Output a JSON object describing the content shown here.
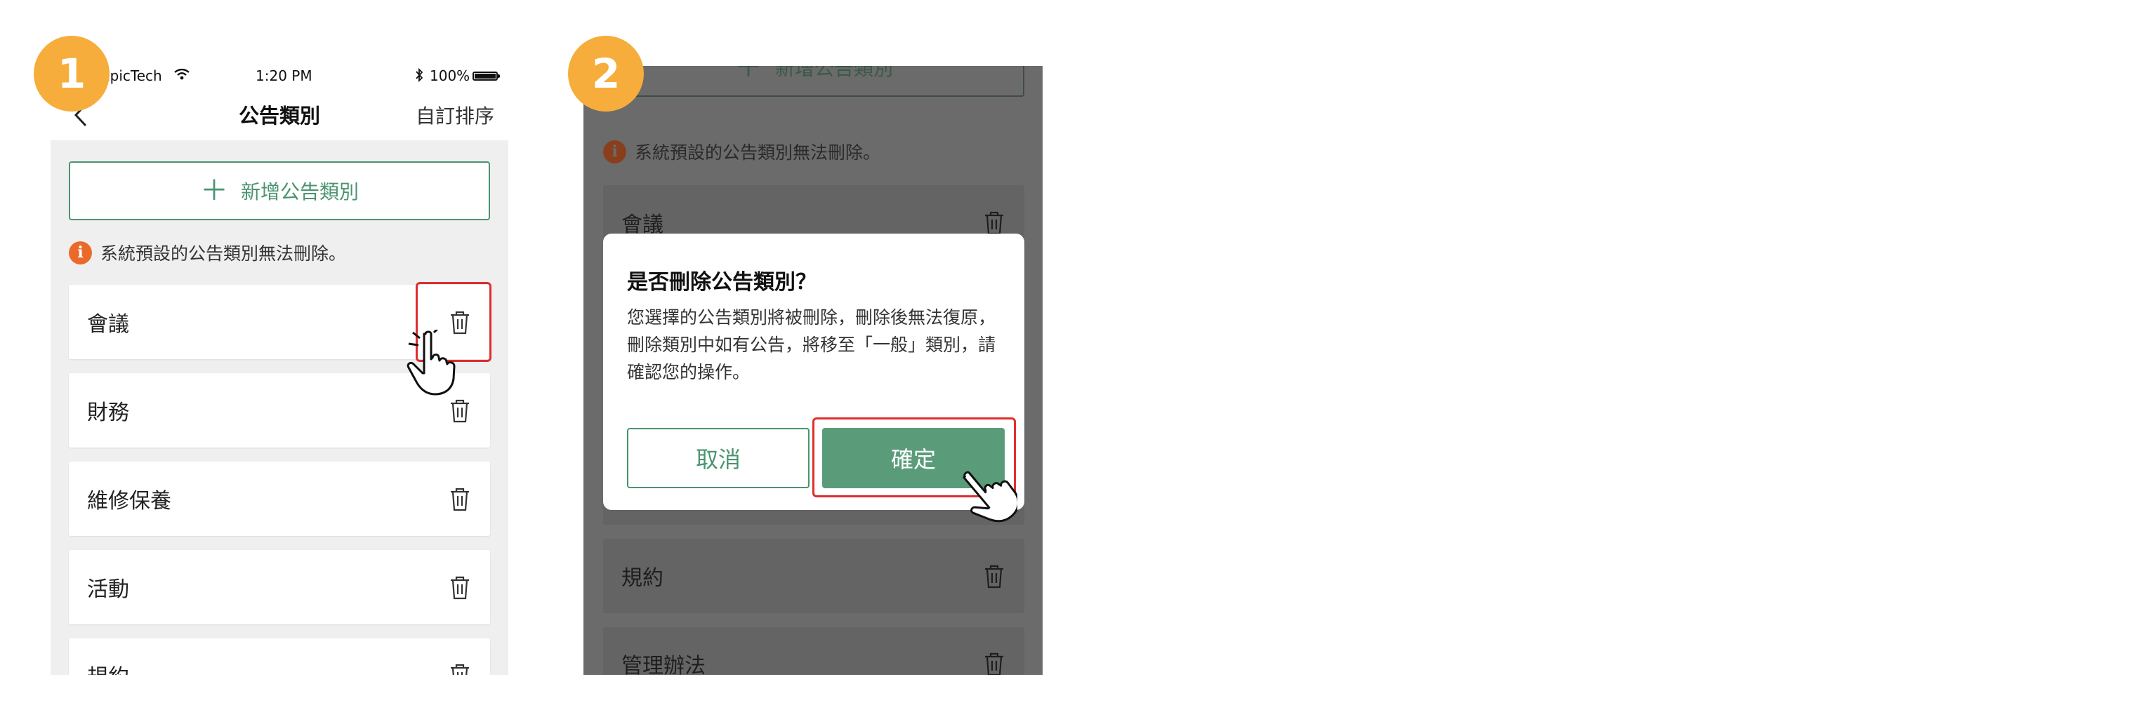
{
  "steps": {
    "step1_label": "1",
    "step2_label": "2"
  },
  "status_bar": {
    "carrier": "EpicTech",
    "time": "1:20 PM",
    "battery": "100%"
  },
  "nav": {
    "back_icon": "chevron-left-icon",
    "title": "公告類別",
    "right_action": "自訂排序"
  },
  "add_button": {
    "icon": "plus-icon",
    "label": "新增公告類別"
  },
  "info": {
    "icon": "info-icon",
    "icon_glyph": "i",
    "text": "系統預設的公告類別無法刪除。"
  },
  "categories": [
    {
      "label": "會議"
    },
    {
      "label": "財務"
    },
    {
      "label": "維修保養"
    },
    {
      "label": "活動"
    },
    {
      "label": "規約"
    },
    {
      "label": "管理辦法"
    }
  ],
  "dialog": {
    "title": "是否刪除公告類別？",
    "message": "您選擇的公告類別將被刪除，刪除後無法復原，刪除類別中如有公告，將移至「一般」類別，請確認您的操作。",
    "cancel_label": "取消",
    "confirm_label": "確定"
  },
  "colors": {
    "accent_green": "#4a9470",
    "confirm_green": "#5a9c7a",
    "step_badge": "#f6ad3c",
    "highlight_red": "#e02d2d",
    "info_orange": "#ea6a2b",
    "overlay": "#6b6b6b"
  }
}
